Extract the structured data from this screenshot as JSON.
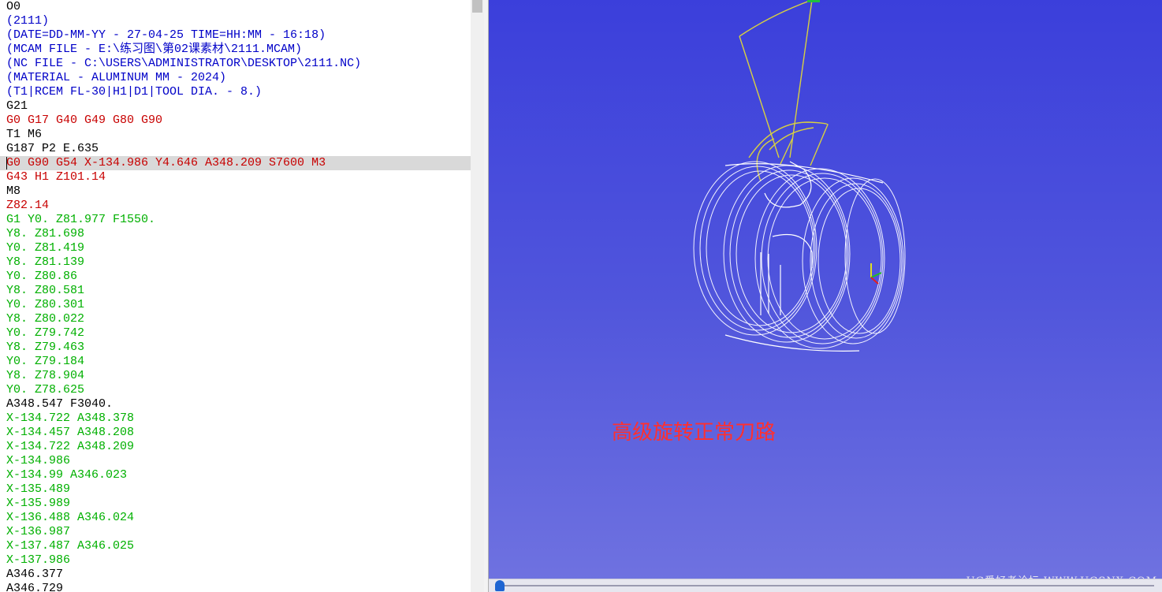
{
  "editor": {
    "lines": [
      {
        "text": "O0",
        "color": "black"
      },
      {
        "text": "(2111)",
        "color": "blue"
      },
      {
        "text": "(DATE=DD-MM-YY - 27-04-25 TIME=HH:MM - 16:18)",
        "color": "blue"
      },
      {
        "text": "(MCAM FILE - E:\\练习图\\第02课素材\\2111.MCAM)",
        "color": "blue"
      },
      {
        "text": "(NC FILE - C:\\USERS\\ADMINISTRATOR\\DESKTOP\\2111.NC)",
        "color": "blue"
      },
      {
        "text": "(MATERIAL - ALUMINUM MM - 2024)",
        "color": "blue"
      },
      {
        "text": "(T1|RCEM FL-30|H1|D1|TOOL DIA. - 8.)",
        "color": "blue"
      },
      {
        "text": "G21",
        "color": "black"
      },
      {
        "text": "G0 G17 G40 G49 G80 G90",
        "color": "red"
      },
      {
        "text": "T1 M6",
        "color": "black"
      },
      {
        "text": "G187 P2 E.635",
        "color": "black"
      },
      {
        "text": "G0 G90 G54 X-134.986 Y4.646 A348.209 S7600 M3",
        "color": "red",
        "current": true
      },
      {
        "text": "G43 H1 Z101.14",
        "color": "red"
      },
      {
        "text": "M8",
        "color": "black"
      },
      {
        "text": "Z82.14",
        "color": "red"
      },
      {
        "text": "G1 Y0. Z81.977 F1550.",
        "color": "green"
      },
      {
        "text": "Y8. Z81.698",
        "color": "green"
      },
      {
        "text": "Y0. Z81.419",
        "color": "green"
      },
      {
        "text": "Y8. Z81.139",
        "color": "green"
      },
      {
        "text": "Y0. Z80.86",
        "color": "green"
      },
      {
        "text": "Y8. Z80.581",
        "color": "green"
      },
      {
        "text": "Y0. Z80.301",
        "color": "green"
      },
      {
        "text": "Y8. Z80.022",
        "color": "green"
      },
      {
        "text": "Y0. Z79.742",
        "color": "green"
      },
      {
        "text": "Y8. Z79.463",
        "color": "green"
      },
      {
        "text": "Y0. Z79.184",
        "color": "green"
      },
      {
        "text": "Y8. Z78.904",
        "color": "green"
      },
      {
        "text": "Y0. Z78.625",
        "color": "green"
      },
      {
        "text": "A348.547 F3040.",
        "color": "black"
      },
      {
        "text": "X-134.722 A348.378",
        "color": "green"
      },
      {
        "text": "X-134.457 A348.208",
        "color": "green"
      },
      {
        "text": "X-134.722 A348.209",
        "color": "green"
      },
      {
        "text": "X-134.986",
        "color": "green"
      },
      {
        "text": "X-134.99 A346.023",
        "color": "green"
      },
      {
        "text": "X-135.489",
        "color": "green"
      },
      {
        "text": "X-135.989",
        "color": "green"
      },
      {
        "text": "X-136.488 A346.024",
        "color": "green"
      },
      {
        "text": "X-136.987",
        "color": "green"
      },
      {
        "text": "X-137.487 A346.025",
        "color": "green"
      },
      {
        "text": "X-137.986",
        "color": "green"
      },
      {
        "text": "A346.377",
        "color": "black"
      },
      {
        "text": "A346.729",
        "color": "black"
      }
    ]
  },
  "viewport": {
    "caption": "高级旋转正常刀路",
    "watermark": "UG爱好者论坛 WWW.UGSNX.COM",
    "colors": {
      "toolpath": "#f2f2ff",
      "tool_holder": "#d8d040",
      "caption": "#ff3030",
      "axis_x": "#e02020",
      "axis_y": "#20c020",
      "axis_z": "#e0e020",
      "slider_thumb": "#1e64d2"
    }
  }
}
